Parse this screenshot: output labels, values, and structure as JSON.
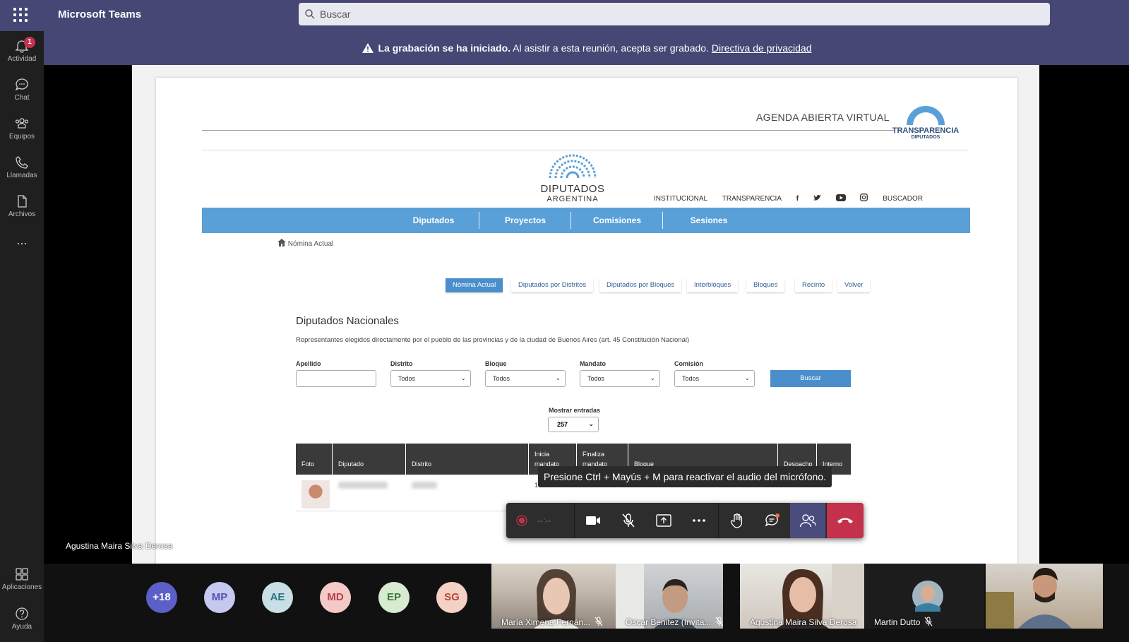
{
  "app": {
    "title": "Microsoft Teams"
  },
  "search": {
    "placeholder": "Buscar"
  },
  "rail": {
    "items": [
      {
        "label": "Actividad",
        "badge": "1"
      },
      {
        "label": "Chat"
      },
      {
        "label": "Equipos"
      },
      {
        "label": "Llamadas"
      },
      {
        "label": "Archivos"
      }
    ],
    "more": "...",
    "bottom": [
      {
        "label": "Aplicaciones"
      },
      {
        "label": "Ayuda"
      }
    ]
  },
  "banner": {
    "bold": "La grabación se ha iniciado.",
    "text": " Al asistir a esta reunión, acepta ser grabado. ",
    "link": "Directiva de privacidad"
  },
  "shared": {
    "agenda": "AGENDA ABIERTA VIRTUAL",
    "transparencia": {
      "title": "TRANSPARENCIA",
      "sub": "DIPUTADOS"
    },
    "logo": {
      "line1": "DIPUTADOS",
      "line2": "ARGENTINA"
    },
    "topnav": [
      "INSTITUCIONAL",
      "TRANSPARENCIA",
      "BUSCADOR"
    ],
    "nav": [
      "Diputados",
      "Proyectos",
      "Comisiones",
      "Sesiones"
    ],
    "breadcrumb": "Nómina Actual",
    "subtabs": [
      "Nómina Actual",
      "Diputados por Distritos",
      "Diputados por Bloques",
      "Interbloques",
      "Bloques",
      "Recinto",
      "Volver"
    ],
    "panel": {
      "title": "Diputados Nacionales",
      "desc": "Representantes elegidos directamente por el pueblo de las provincias y de la ciudad de Buenos Aires (art. 45 Constitución Nacional)",
      "filters": {
        "apellido": "Apellido",
        "distrito": {
          "label": "Distrito",
          "value": "Todos"
        },
        "bloque": {
          "label": "Bloque",
          "value": "Todos"
        },
        "mandato": {
          "label": "Mandato",
          "value": "Todos"
        },
        "comision": {
          "label": "Comisión",
          "value": "Todos"
        },
        "buscar": "Buscar"
      },
      "mostrar": {
        "label": "Mostrar entradas",
        "value": "257"
      },
      "columns": [
        "Foto",
        "Diputado",
        "Distrito",
        "Inicia mandato",
        "Finaliza mandato",
        "Bloque",
        "Despacho",
        "Interno"
      ],
      "row1": {
        "inicia": "10/12/2"
      }
    }
  },
  "toast": "Presione Ctrl + Mayús + M para reactivar el audio del micrófono.",
  "callbar": {
    "timer": "--:--"
  },
  "presenter": "Agustina Maira Silva Derosa",
  "gallery": {
    "avatars": [
      {
        "initials": "+18",
        "bg": "#5b5fc7",
        "fg": "#ffffff"
      },
      {
        "initials": "MP",
        "bg": "#c5c9f0",
        "fg": "#4f52b2"
      },
      {
        "initials": "AE",
        "bg": "#c8dfe6",
        "fg": "#2f6f83"
      },
      {
        "initials": "MD",
        "bg": "#f4c9c7",
        "fg": "#b5404a"
      },
      {
        "initials": "EP",
        "bg": "#d6ebd0",
        "fg": "#3f7a34"
      },
      {
        "initials": "SG",
        "bg": "#f5d0c5",
        "fg": "#b24a35"
      }
    ],
    "tiles": [
      {
        "name": "María Ximena Fernán..."
      },
      {
        "name": "Oscar Benitez (Invita..."
      },
      {
        "name": "Agustina Maira Silva Derosa"
      },
      {
        "name": "Martin Dutto"
      },
      {
        "name": ""
      }
    ]
  }
}
